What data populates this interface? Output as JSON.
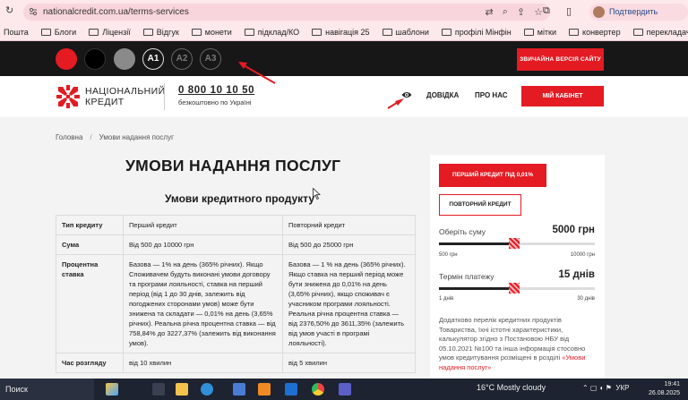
{
  "browser": {
    "url": "nationalcredit.com.ua/terms-services",
    "profile_label": "Подтвердить личность",
    "bookmarks": [
      "Пошта",
      "Блоги",
      "Ліцензії",
      "Відгук",
      "монети",
      "підклад/КО",
      "навігація 25",
      "шаблони",
      "профілі Мінфін",
      "мітки",
      "конвертер",
      "перекладач"
    ]
  },
  "a11y_bar": {
    "swatch_colors": [
      "#e41b23",
      "#000000",
      "#8a8a8a"
    ],
    "font_sizes": [
      "A1",
      "A2",
      "A3"
    ],
    "vision_button": "ЗВИЧАЙНА ВЕРСІЯ САЙТУ"
  },
  "header": {
    "logo_line1": "НАЦІОНАЛЬНИЙ",
    "logo_line2": "КРЕДИТ",
    "phone": "0 800 10 10 50",
    "phone_note": "безкоштовно по Україні",
    "nav": [
      "ДОВІДКА",
      "ПРО НАС"
    ],
    "cabinet": "МІЙ КАБІНЕТ"
  },
  "breadcrumb": [
    "Головна",
    "Умови надання послуг"
  ],
  "page_title": "УМОВИ НАДАННЯ ПОСЛУГ",
  "section_title": "Умови кредитного продукту",
  "table": {
    "headers": [
      "Тип кредиту",
      "Перший кредит",
      "Повторний кредит"
    ],
    "rows": [
      [
        "Сума",
        "Від 500 до 10000 грн",
        "Від 500 до 25000 грн"
      ],
      [
        "Процентна ставка",
        "Базова — 1% на день (365% річних). Якщо Споживачем будуть виконані умови договору та програми лояльності, ставка на перший період (від 1 до 30 днів, залежить від погоджених сторонами умов) може бути знижена та складати — 0,01% на день (3,65% річних). Реальна річна процентна ставка — від 758,84% до 3227,37% (залежить від виконання умов).",
        "Базова — 1 % на день (365% річних). Якщо ставка на перший період може бути знижена до 0,01% на день (3,65% річних), якщо споживач є учасником програми лояльності. Реальна річна процентна ставка — від 2376,50% до 3611,35% (залежить від умов участі в програмі лояльності)."
      ],
      [
        "Час розгляду",
        "від 10 хвилин",
        "від 5 хвилин"
      ]
    ]
  },
  "calculator": {
    "btn_first": "ПЕРШИЙ КРЕДИТ ПІД 0,01%",
    "btn_repeat": "ПОВТОРНИЙ КРЕДИТ",
    "sum_label": "Оберіть суму",
    "sum_value": "5000 грн",
    "sum_min": "500 грн",
    "sum_max": "10000 грн",
    "sum_fraction": 0.48,
    "term_label": "Термін платежу",
    "term_value": "15 днів",
    "term_min": "1 днів",
    "term_max": "30 днів",
    "term_fraction": 0.48,
    "info_text": "Додатково перелік кредитних продуктів Товариства, їхні істотні характеристики, калькулятор згідно з Постановою НБУ від 05.10.2021 №100 та інша інформація стосовно умов кредитування розміщені в розділі ",
    "info_link": "«Умови надання послуг»"
  },
  "taskbar": {
    "search": "Поиск",
    "weather": "16°C  Mostly cloudy",
    "lang": "УКР",
    "time": "19:41",
    "date": "26.08.2025"
  }
}
